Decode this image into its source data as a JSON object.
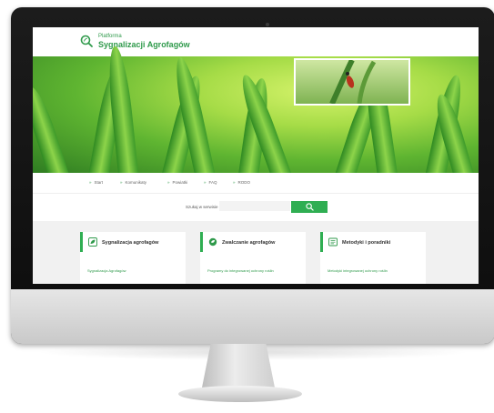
{
  "site": {
    "logo_small": "Platforma",
    "logo_big": "Sygnalizacji Agrofagów"
  },
  "nav": {
    "items": [
      "Start",
      "Komunikaty",
      "Powiatki",
      "FAQ",
      "RODO"
    ]
  },
  "search": {
    "label": "Szukaj w serwisie"
  },
  "cards": [
    {
      "title": "Sygnalizacja agrofagów",
      "link": "Sygnalizacja Agrofagów"
    },
    {
      "title": "Zwalczanie agrofagów",
      "link": "Programy do integrowanej ochrony roślin"
    },
    {
      "title": "Metodyki i poradniki",
      "link": "Metodyki integrowanej ochrony roślin"
    }
  ],
  "colors": {
    "brand_green": "#2fae52",
    "text_green": "#2f9a4b"
  }
}
